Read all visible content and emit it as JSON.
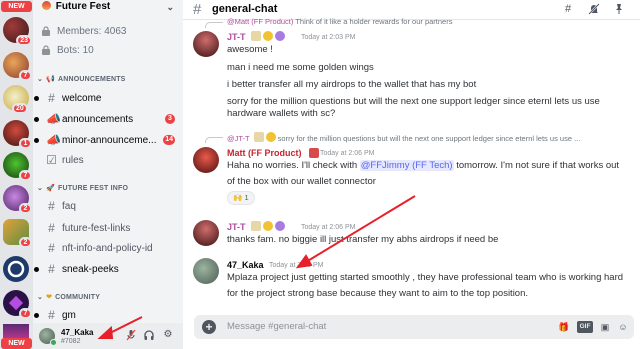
{
  "rail": {
    "badges": [
      "23",
      "7",
      "20",
      "1",
      "7",
      "2",
      "2",
      "7"
    ],
    "new_labels": [
      "NEW",
      "NEW"
    ]
  },
  "server": {
    "name": "Future Fest",
    "stats": {
      "members": "Members: 4063",
      "bots": "Bots: 10"
    }
  },
  "categories": {
    "announcements": "ANNOUNCEMENTS",
    "future_fest_info": "FUTURE FEST INFO",
    "community": "COMMUNITY"
  },
  "channels": {
    "welcome": "welcome",
    "announcements": "announcements",
    "announcements_count": "3",
    "minor": "minor-announceme...",
    "minor_count": "14",
    "rules": "rules",
    "faq": "faq",
    "links": "future-fest-links",
    "nft": "nft-info-and-policy-id",
    "sneak": "sneak-peeks",
    "gm": "gm"
  },
  "user_panel": {
    "name": "47_Kaka",
    "tag": "#7082"
  },
  "header": {
    "channel": "general-chat"
  },
  "messages": {
    "top_reply": {
      "name": "@Matt (FF Product)",
      "text": "Think of it like a holder rewards for our partners"
    },
    "m1": {
      "name": "JT-T",
      "time": "Today at 2:03 PM",
      "lines": [
        "awesome !",
        "man i need me some golden wings",
        "i better transfer all my airdrops to the wallet that has my bot",
        "sorry for the million questions but will the next one support ledger since eternl lets us use",
        "hardware wallets with sc?"
      ],
      "name_color": "#b14d9d"
    },
    "m2": {
      "reply_name": "@JT-T",
      "reply_text": "sorry for the million questions but will the next one support ledger since eternl lets us use ...",
      "name": "Matt (FF Product)",
      "time": "Today at 2:06 PM",
      "line1_a": "Haha no worries. I'll check with ",
      "mention": "@FFJimmy (FF Tech)",
      "line1_b": " tomorrow. I'm not sure if that works out",
      "line2": "of the box with our wallet connector",
      "reaction_count": "1",
      "name_color": "#c8232e"
    },
    "m3": {
      "name": "JT-T",
      "time": "Today at 2:06 PM",
      "line": "thanks fam. no biggie ill just transfer my abhs airdrops if need be",
      "name_color": "#b14d9d"
    },
    "m4": {
      "name": "47_Kaka",
      "time": "Today at 7:28 PM",
      "line1": "Mplaza project just getting started smoothly , they have professional team who is working hard",
      "line2": "for the project strong base because they want to aim to the top position.",
      "name_color": "#060607"
    }
  },
  "composer": {
    "placeholder": "Message #general-chat",
    "gif": "GIF"
  },
  "colors": {
    "accent": "#5865f2",
    "danger": "#ed4245",
    "annotation": "#e8202a"
  }
}
